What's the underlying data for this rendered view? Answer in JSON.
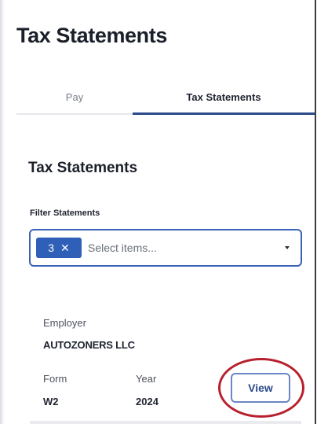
{
  "page": {
    "title": "Tax Statements"
  },
  "tabs": [
    {
      "label": "Pay",
      "active": false
    },
    {
      "label": "Tax Statements",
      "active": true
    }
  ],
  "section": {
    "title": "Tax Statements",
    "filter_label": "Filter Statements",
    "filter": {
      "selected_count": "3",
      "chip_remove": "✕",
      "placeholder": "Select items..."
    }
  },
  "statement": {
    "employer_label": "Employer",
    "employer_value": "AUTOZONERS LLC",
    "form_label": "Form",
    "form_value": "W2",
    "year_label": "Year",
    "year_value": "2024",
    "view_label": "View"
  },
  "colors": {
    "accent": "#2f5fb7",
    "tab_underline": "#2b4a8a",
    "annotation": "#b8202e"
  },
  "icons": {
    "chip_remove": "close-icon",
    "select_caret": "chevron-down-icon"
  }
}
